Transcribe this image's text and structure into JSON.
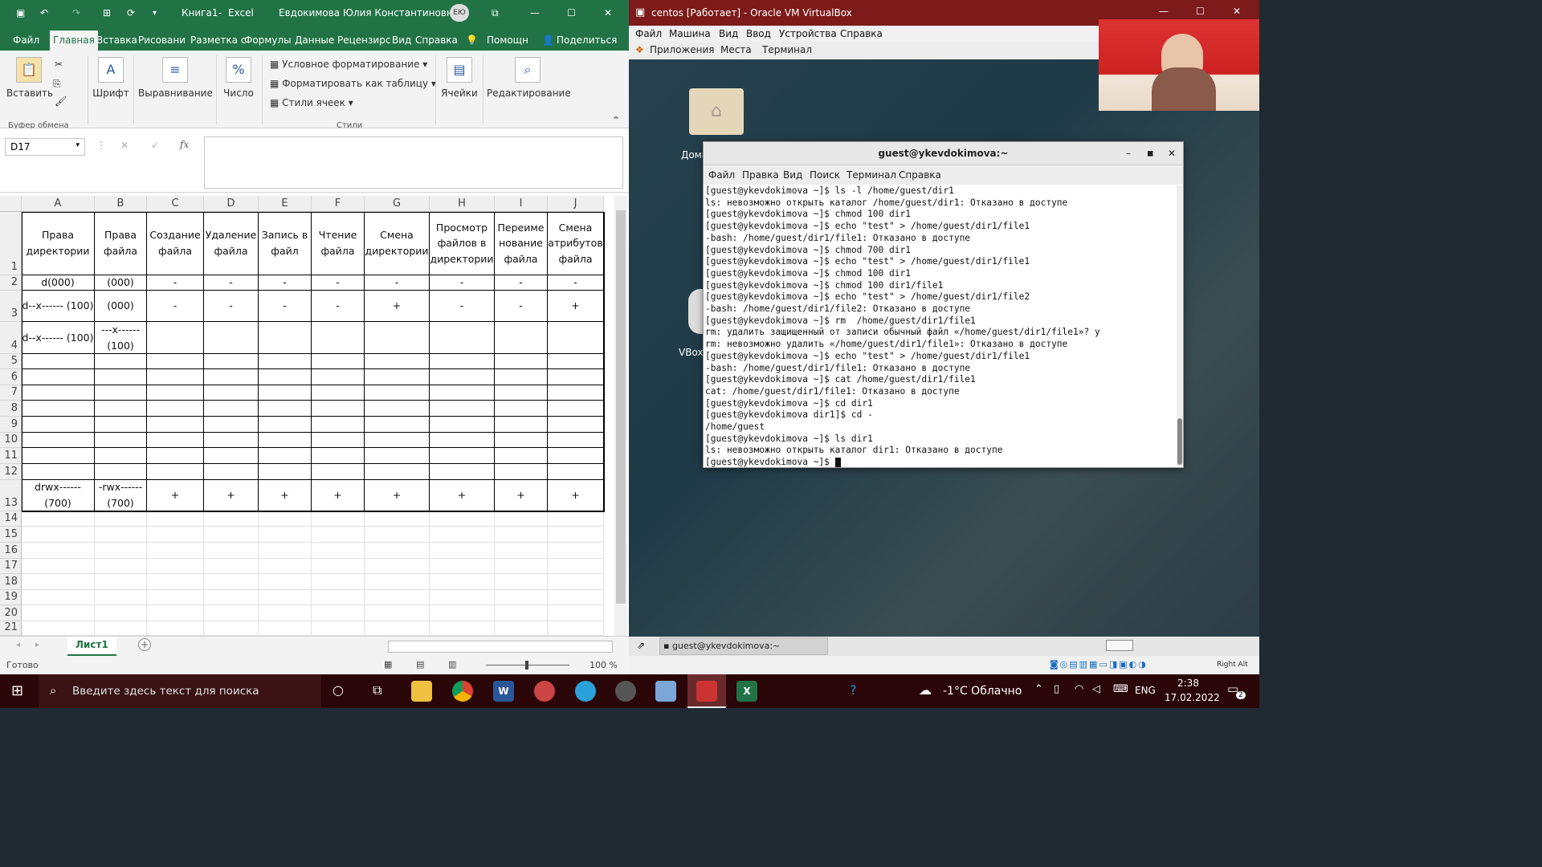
{
  "excel": {
    "titlebar": {
      "book": "Книга1",
      "sep": "-",
      "app": "Excel",
      "user": "Евдокимова Юлия Константиновна",
      "initials": "ЕЮ"
    },
    "tabs": [
      "Файл",
      "Главная",
      "Вставка",
      "Рисовани",
      "Разметка с",
      "Формулы",
      "Данные",
      "Рецензирс",
      "Вид",
      "Справка"
    ],
    "help_search": "Помощн",
    "share": "Поделиться",
    "ribbon": {
      "paste": "Вставить",
      "clipboard_group": "Буфер обмена",
      "font": "Шрифт",
      "alignment": "Выравнивание",
      "number": "Число",
      "cond_format": "Условное форматирование",
      "format_table": "Форматировать как таблицу",
      "cell_styles": "Стили ячеек",
      "styles_group": "Стили",
      "cells": "Ячейки",
      "editing": "Редактирование"
    },
    "namebox": "D17",
    "fx": "fx",
    "columns": [
      "A",
      "B",
      "C",
      "D",
      "E",
      "F",
      "G",
      "H",
      "I",
      "J"
    ],
    "headers": [
      "Права директории",
      "Права файла",
      "Создание файла",
      "Удаление файла",
      "Запись в файл",
      "Чтение файла",
      "Смена директории",
      "Просмотр файлов в директории",
      "Переиме нование файла",
      "Смена атрибутов файла"
    ],
    "row2": [
      "d(000)",
      "(000)",
      "-",
      "-",
      "-",
      "-",
      "-",
      "-",
      "-",
      "-"
    ],
    "row3": [
      "d--x------ (100)",
      "(000)",
      "-",
      "-",
      "-",
      "-",
      "+",
      "-",
      "-",
      "+"
    ],
    "row4": [
      "d--x------ (100)",
      "---x------ (100)",
      "",
      "",
      "",
      "",
      "",
      "",
      "",
      ""
    ],
    "row13": [
      "drwx------ (700)",
      "-rwx------ (700)",
      "+",
      "+",
      "+",
      "+",
      "+",
      "+",
      "+",
      "+"
    ],
    "row_numbers": [
      "1",
      "2",
      "3",
      "4",
      "5",
      "6",
      "7",
      "8",
      "9",
      "10",
      "11",
      "12",
      "13",
      "14",
      "15",
      "16",
      "17",
      "18",
      "19",
      "20",
      "21"
    ],
    "sheet": "Лист1",
    "status": "Готово",
    "zoom": "100 %"
  },
  "vbox": {
    "title": "centos [Работает] - Oracle VM VirtualBox",
    "menu": [
      "Файл",
      "Машина",
      "Вид",
      "Ввод",
      "Устройства",
      "Справка"
    ],
    "gnome": [
      "Приложения",
      "Места",
      "Терминал"
    ],
    "desktop_home": "Дома",
    "desktop_vbox": "VBox",
    "terminal": {
      "title": "guest@ykevdokimova:~",
      "menu": [
        "Файл",
        "Правка",
        "Вид",
        "Поиск",
        "Терминал",
        "Справка"
      ],
      "lines": [
        "[guest@ykevdokimova ~]$ ls -l /home/guest/dir1",
        "ls: невозможно открыть каталог /home/guest/dir1: Отказано в доступе",
        "[guest@ykevdokimova ~]$ chmod 100 dir1",
        "[guest@ykevdokimova ~]$ echo \"test\" > /home/guest/dir1/file1",
        "-bash: /home/guest/dir1/file1: Отказано в доступе",
        "[guest@ykevdokimova ~]$ chmod 700 dir1",
        "[guest@ykevdokimova ~]$ echo \"test\" > /home/guest/dir1/file1",
        "[guest@ykevdokimova ~]$ chmod 100 dir1",
        "[guest@ykevdokimova ~]$ chmod 100 dir1/file1",
        "[guest@ykevdokimova ~]$ echo \"test\" > /home/guest/dir1/file2",
        "-bash: /home/guest/dir1/file2: Отказано в доступе",
        "[guest@ykevdokimova ~]$ rm  /home/guest/dir1/file1",
        "rm: удалить защищенный от записи обычный файл «/home/guest/dir1/file1»? y",
        "rm: невозможно удалить «/home/guest/dir1/file1»: Отказано в доступе",
        "[guest@ykevdokimova ~]$ echo \"test\" > /home/guest/dir1/file1",
        "-bash: /home/guest/dir1/file1: Отказано в доступе",
        "[guest@ykevdokimova ~]$ cat /home/guest/dir1/file1",
        "cat: /home/guest/dir1/file1: Отказано в доступе",
        "[guest@ykevdokimova ~]$ cd dir1",
        "[guest@ykevdokimova dir1]$ cd -",
        "/home/guest",
        "[guest@ykevdokimova ~]$ ls dir1",
        "ls: невозможно открыть каталог dir1: Отказано в доступе",
        "[guest@ykevdokimova ~]$ "
      ]
    },
    "taskbar_item": "guest@ykevdokimova:~",
    "hostkey": "Right Alt"
  },
  "taskbar": {
    "search": "Введите здесь текст для поиска",
    "weather": "-1°C Облачно",
    "lang": "ENG",
    "time": "2:38",
    "date": "17.02.2022",
    "notif": "2"
  }
}
